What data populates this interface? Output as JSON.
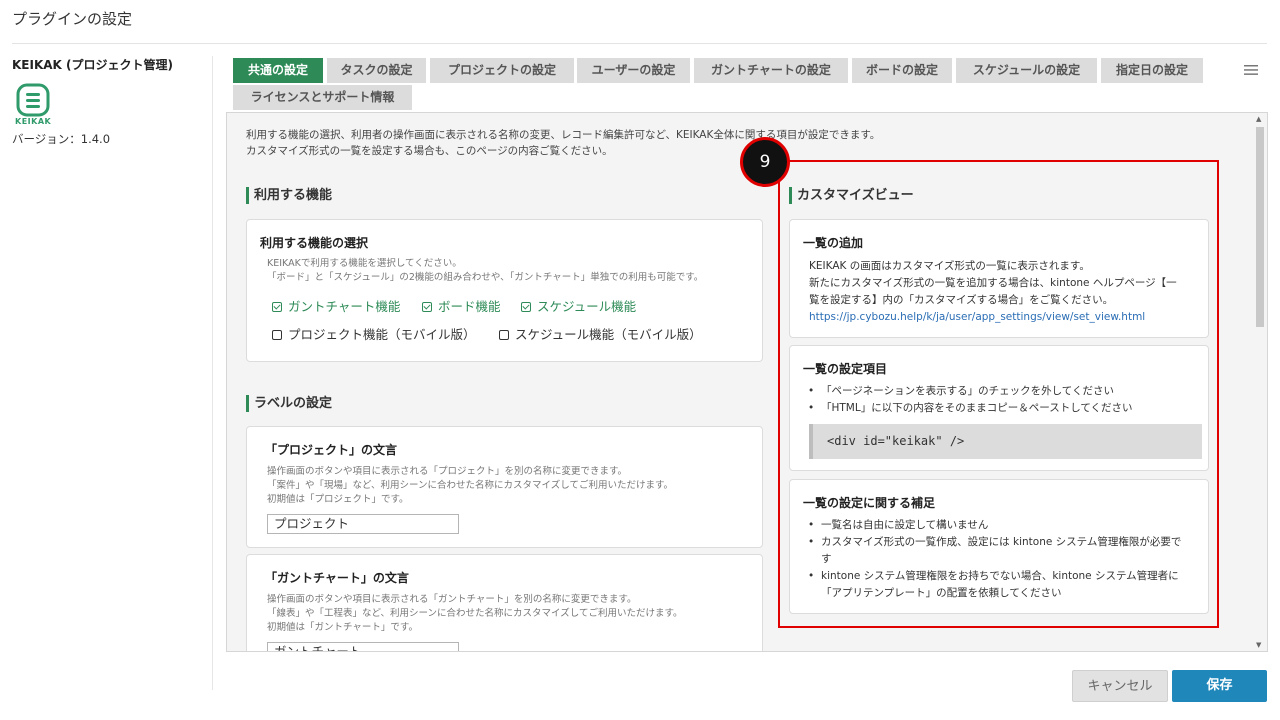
{
  "page_title": "プラグインの設定",
  "sidebar": {
    "plugin_name": "KEIKAK (プロジェクト管理)",
    "logo_text": "KEIKAK",
    "version": "バージョン：1.4.0"
  },
  "tabs": [
    {
      "label": "共通の設定",
      "active": true
    },
    {
      "label": "タスクの設定",
      "active": false
    },
    {
      "label": "プロジェクトの設定",
      "active": false
    },
    {
      "label": "ユーザーの設定",
      "active": false
    },
    {
      "label": "ガントチャートの設定",
      "active": false
    },
    {
      "label": "ボードの設定",
      "active": false
    },
    {
      "label": "スケジュールの設定",
      "active": false
    },
    {
      "label": "指定日の設定",
      "active": false
    },
    {
      "label": "ライセンスとサポート情報",
      "active": false
    }
  ],
  "intro": {
    "line1": "利用する機能の選択、利用者の操作画面に表示される名称の変更、レコード編集許可など、KEIKAK全体に関する項目が設定できます。",
    "line2": "カスタマイズ形式の一覧を設定する場合も、このページの内容ご覧ください。"
  },
  "features": {
    "heading": "利用する機能",
    "card_title": "利用する機能の選択",
    "desc1": "KEIKAKで利用する機能を選択してください。",
    "desc2": "「ボード」と「スケジュール」の2機能の組み合わせや、「ガントチャート」単独での利用も可能です。",
    "options": [
      {
        "label": "ガントチャート機能",
        "checked": true
      },
      {
        "label": "ボード機能",
        "checked": true
      },
      {
        "label": "スケジュール機能",
        "checked": true
      },
      {
        "label": "プロジェクト機能（モバイル版）",
        "checked": false
      },
      {
        "label": "スケジュール機能（モバイル版）",
        "checked": false
      }
    ]
  },
  "labels": {
    "heading": "ラベルの設定",
    "project": {
      "title": "「プロジェクト」の文言",
      "desc1": "操作画面のボタンや項目に表示される「プロジェクト」を別の名称に変更できます。",
      "desc2": "「案件」や「現場」など、利用シーンに合わせた名称にカスタマイズしてご利用いただけます。",
      "desc3": "初期値は「プロジェクト」です。",
      "value": "プロジェクト"
    },
    "gantt": {
      "title": "「ガントチャート」の文言",
      "desc1": "操作画面のボタンや項目に表示される「ガントチャート」を別の名称に変更できます。",
      "desc2": "「線表」や「工程表」など、利用シーンに合わせた名称にカスタマイズしてご利用いただけます。",
      "desc3": "初期値は「ガントチャート」です。",
      "value": "ガントチャート"
    }
  },
  "custom_view": {
    "heading": "カスタマイズビュー",
    "add": {
      "title": "一覧の追加",
      "line1": "KEIKAK の画面はカスタマイズ形式の一覧に表示されます。",
      "line2": "新たにカスタマイズ形式の一覧を追加する場合は、kintone ヘルプページ【一",
      "line3": "覧を設定する】内の「カスタマイズする場合」をご覧ください。",
      "link": "https://jp.cybozu.help/k/ja/user/app_settings/view/set_view.html"
    },
    "settings": {
      "title": "一覧の設定項目",
      "bullet1": "「ページネーションを表示する」のチェックを外してください",
      "bullet2": "「HTML」に以下の内容をそのままコピー＆ペーストしてください",
      "code": "<div id=\"keikak\" />"
    },
    "notes": {
      "title": "一覧の設定に関する補足",
      "bullet1": "一覧名は自由に設定して構いません",
      "bullet2a": "カスタマイズ形式の一覧作成、設定には kintone システム管理権限が必要で",
      "bullet2b": "す",
      "bullet3a": "kintone システム管理権限をお持ちでない場合、kintone システム管理者に",
      "bullet3b": "「アプリテンプレート」の配置を依頼してください"
    }
  },
  "annotation_number": "9",
  "buttons": {
    "cancel": "キャンセル",
    "save": "保存"
  },
  "colors": {
    "accent_green": "#2e8b57",
    "save_blue": "#1f87ba",
    "highlight_red": "#e00000"
  }
}
